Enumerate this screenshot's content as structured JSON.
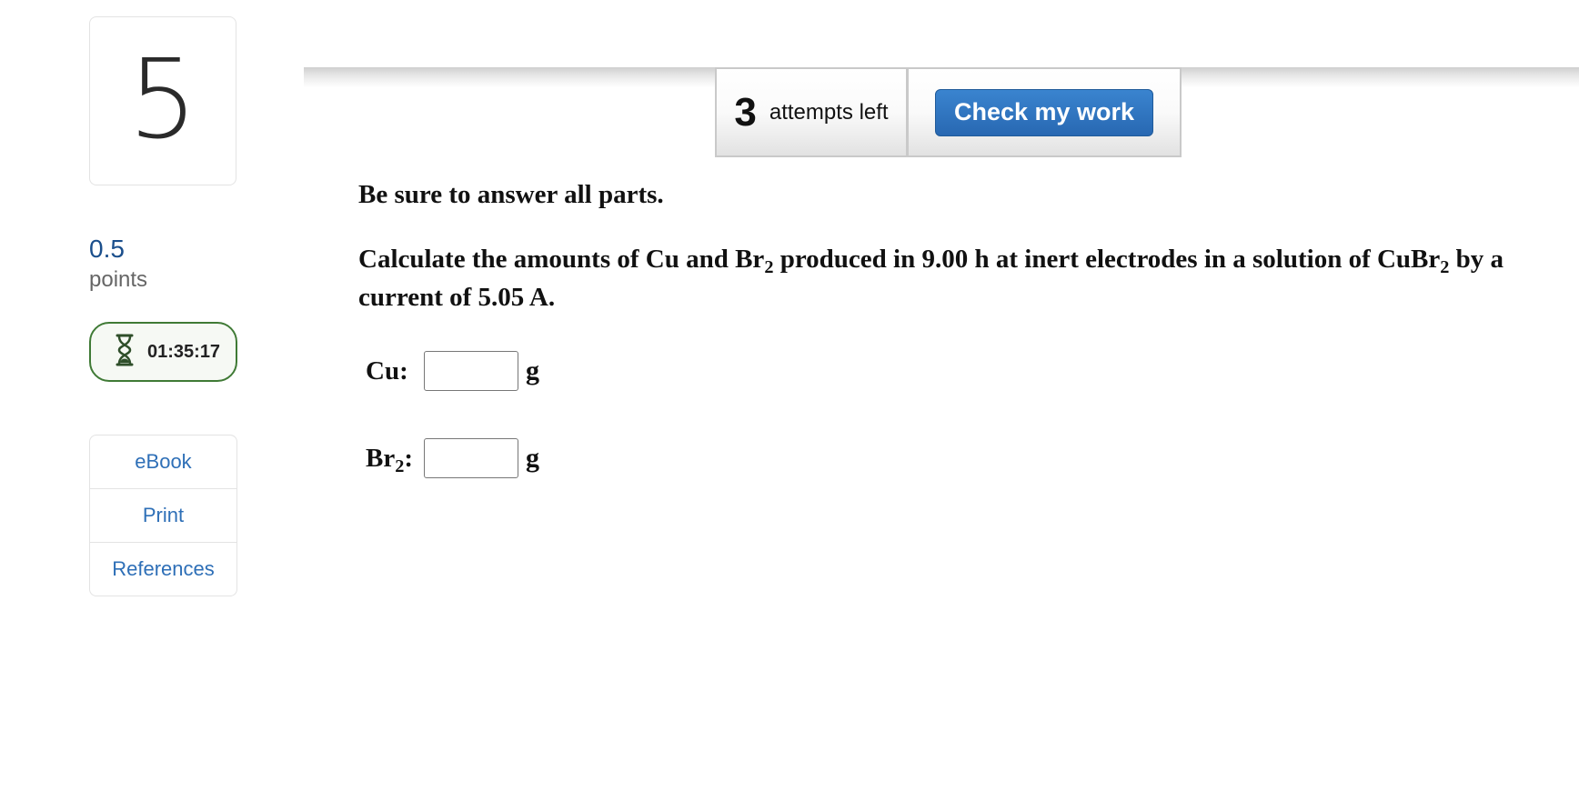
{
  "sidebar": {
    "question_number": "5",
    "points_value": "0.5",
    "points_label": "points",
    "timer": "01:35:17",
    "links": [
      {
        "label": "eBook"
      },
      {
        "label": "Print"
      },
      {
        "label": "References"
      }
    ]
  },
  "toolbar": {
    "attempts_count": "3",
    "attempts_label": "attempts left",
    "check_button_label": "Check my work"
  },
  "question": {
    "instruction": "Be sure to answer all parts.",
    "text_1": "Calculate the amounts of Cu and Br",
    "sub_1": "2",
    "text_2": " produced in 9.00 h at inert electrodes in a solution of CuBr",
    "sub_2": "2",
    "text_3": " by a current of 5.05 A."
  },
  "answers": {
    "cu": {
      "label": "Cu:",
      "value": "",
      "unit": "g"
    },
    "br": {
      "label_main": "Br",
      "label_sub": "2",
      "label_colon": ":",
      "value": "",
      "unit": "g"
    }
  },
  "colors": {
    "accent": "#2e6fb7",
    "timer_border": "#3f7a35",
    "button": "#2a6db4"
  }
}
